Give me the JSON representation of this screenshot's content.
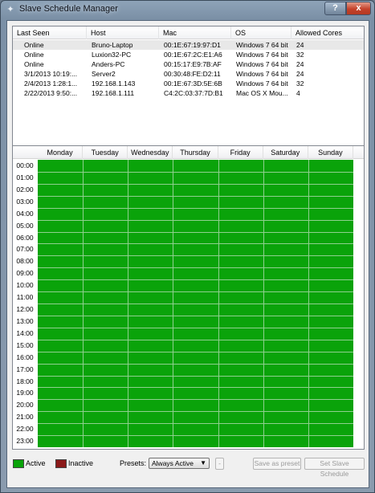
{
  "window": {
    "title": "Slave Schedule Manager",
    "help_label": "?",
    "close_label": "x"
  },
  "slave_list": {
    "columns": [
      "Last Seen",
      "Host",
      "Mac",
      "OS",
      "Allowed Cores"
    ],
    "rows": [
      [
        "Online",
        "Bruno-Laptop",
        "00:1E:67:19:97:D1",
        "Windows 7 64 bit",
        "24"
      ],
      [
        "Online",
        "Luxion32-PC",
        "00:1E:67:2C:E1:A6",
        "Windows 7 64 bit",
        "32"
      ],
      [
        "Online",
        "Anders-PC",
        "00:15:17:E9:7B:AF",
        "Windows 7 64 bit",
        "24"
      ],
      [
        "3/1/2013 10:19:...",
        "Server2",
        "00:30:48:FE:D2:11",
        "Windows 7 64 bit",
        "24"
      ],
      [
        "2/4/2013 1:28:1...",
        "192.168.1.143",
        "00:1E:67:3D:5E:6B",
        "Windows 7 64 bit",
        "32"
      ],
      [
        "2/22/2013 9:50:...",
        "192.168.1.111",
        "C4:2C:03:37:7D:B1",
        "Mac OS X Mou...",
        "4"
      ]
    ],
    "selected_row": 0
  },
  "schedule": {
    "days": [
      "Monday",
      "Tuesday",
      "Wednesday",
      "Thursday",
      "Friday",
      "Saturday",
      "Sunday"
    ],
    "hours": [
      "00:00",
      "01:00",
      "02:00",
      "03:00",
      "04:00",
      "05:00",
      "06:00",
      "07:00",
      "08:00",
      "09:00",
      "10:00",
      "11:00",
      "12:00",
      "13:00",
      "14:00",
      "15:00",
      "16:00",
      "17:00",
      "18:00",
      "19:00",
      "20:00",
      "21:00",
      "22:00",
      "23:00"
    ],
    "all_active": true
  },
  "footer": {
    "active_label": "Active",
    "inactive_label": "Inactive",
    "presets_label": "Presets:",
    "preset_value": "Always Active",
    "remove_preset_label": "-",
    "save_preset_label": "Save as preset",
    "set_schedule_label": "Set Slave Schedule"
  },
  "colors": {
    "active": "#0aa30a",
    "inactive": "#8b1a1a",
    "titlebar": "#7b90a6"
  }
}
